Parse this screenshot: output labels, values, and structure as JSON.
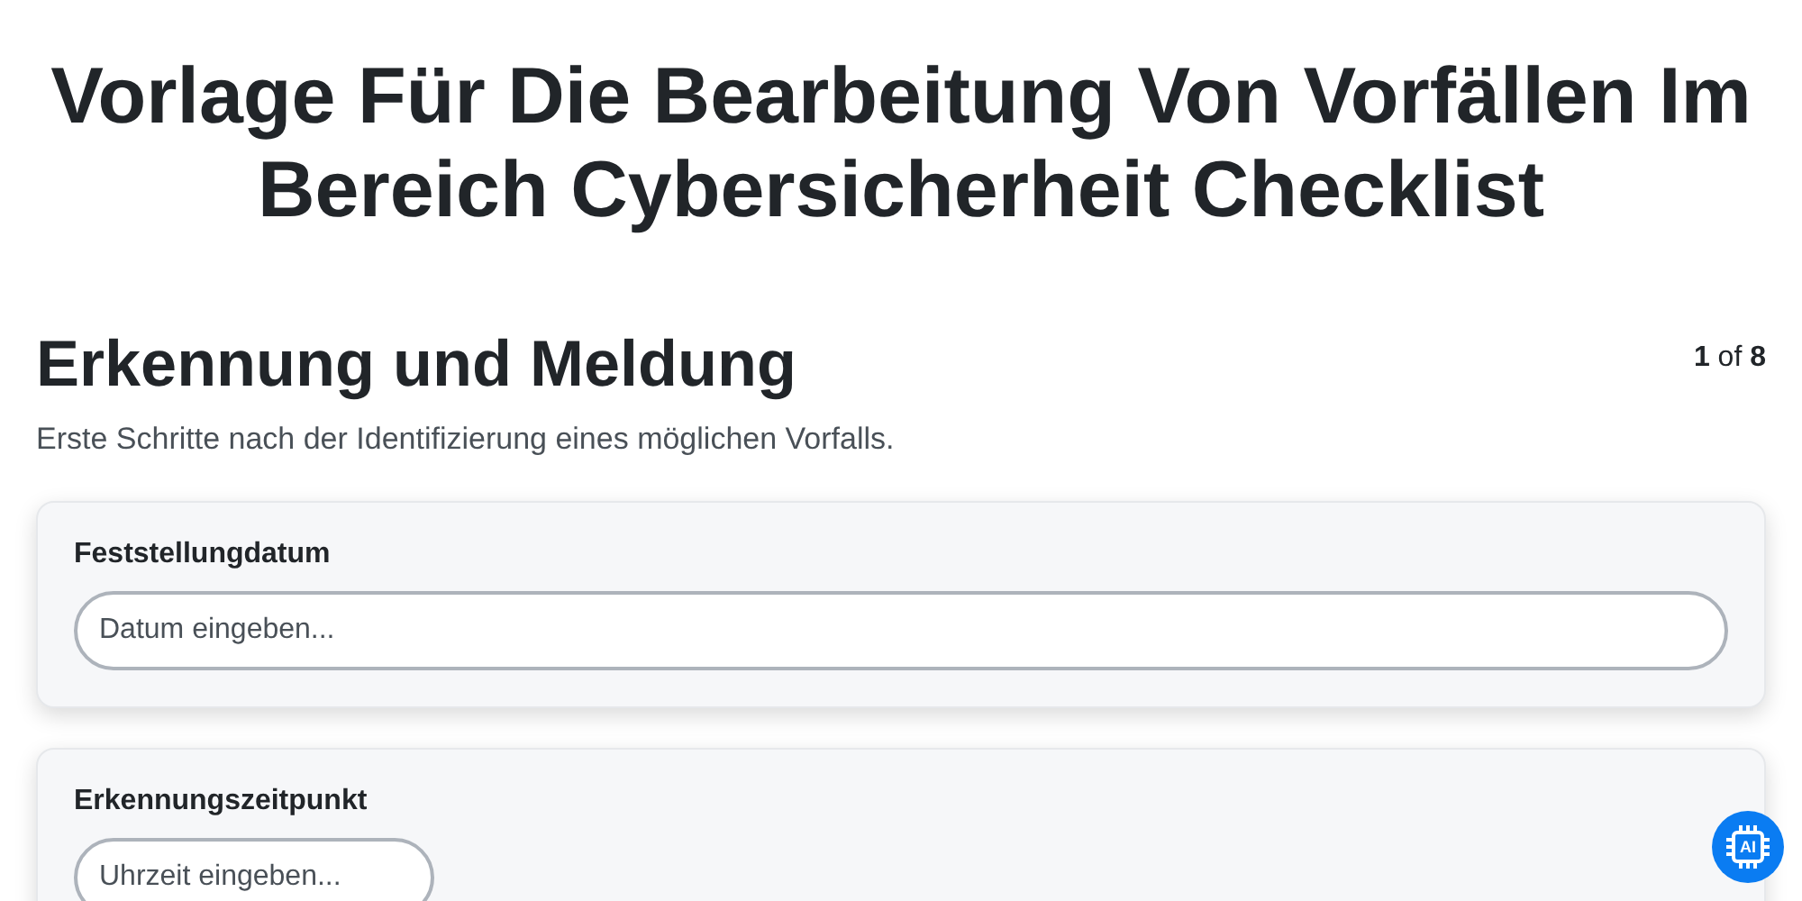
{
  "title": "Vorlage Für Die Bearbeitung Von Vorfällen Im Bereich Cybersicherheit Checklist",
  "section": {
    "heading": "Erkennung und Meldung",
    "pager": "**1** of **8**",
    "description": "Erste Schritte nach der Identifizierung eines möglichen Vorfalls."
  },
  "fields": [
    {
      "label": "Feststellungdatum",
      "kind": "date",
      "placeholder": "Datum eingeben..."
    },
    {
      "label": "Erkennungszeitpunkt",
      "kind": "time",
      "placeholder": "Uhrzeit eingeben..."
    }
  ],
  "ai_button": {
    "label": "AI"
  }
}
